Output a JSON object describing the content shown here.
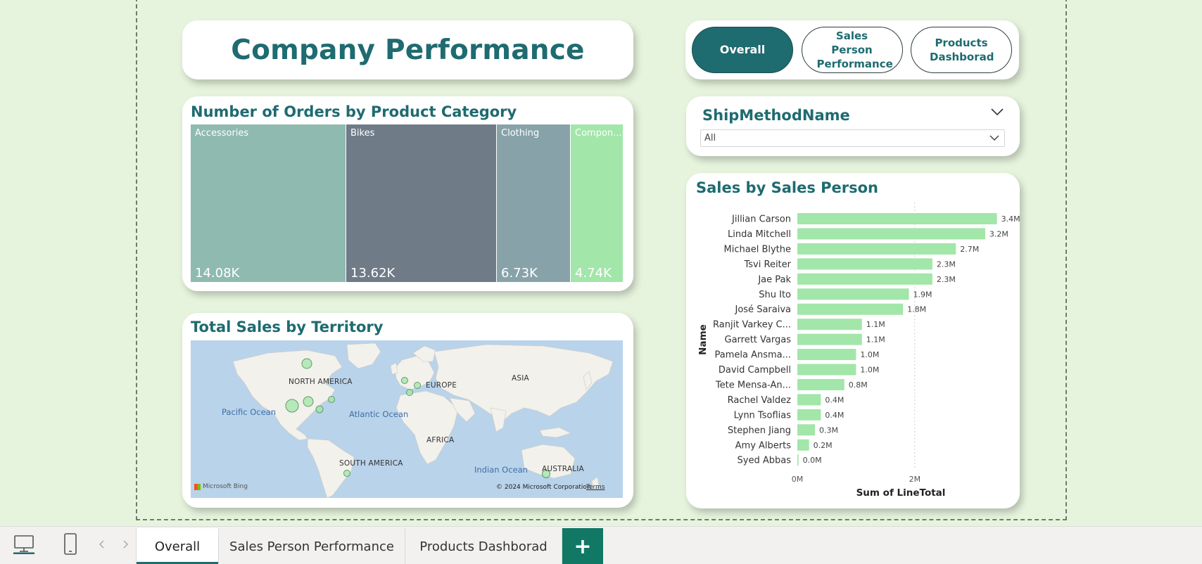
{
  "header": {
    "title": "Company Performance"
  },
  "nav_buttons": [
    {
      "label": "Overall",
      "active": true
    },
    {
      "label": "Sales Person Performance",
      "active": false
    },
    {
      "label": "Products Dashborad",
      "active": false
    }
  ],
  "treemap": {
    "title": "Number of Orders by Product Category",
    "tiles": [
      {
        "label": "Accessories",
        "value": "14.08K",
        "color": "#8fbab0"
      },
      {
        "label": "Bikes",
        "value": "13.62K",
        "color": "#6f7b87"
      },
      {
        "label": "Clothing",
        "value": "6.73K",
        "color": "#87a3a9"
      },
      {
        "label": "Compon...",
        "value": "4.74K",
        "color": "#a2e6a9"
      }
    ]
  },
  "map": {
    "title": "Total Sales by Territory",
    "labels": {
      "north_america": "NORTH AMERICA",
      "europe": "EUROPE",
      "asia": "ASIA",
      "africa": "AFRICA",
      "south_america": "SOUTH AMERICA",
      "australia": "AUSTRALIA",
      "pacific": "Pacific Ocean",
      "atlantic": "Atlantic Ocean",
      "indian": "Indian Ocean"
    },
    "bing": "Microsoft Bing",
    "copyright": "© 2024 Microsoft Corporation",
    "terms": "Terms"
  },
  "slicer": {
    "title": "ShipMethodName",
    "value": "All"
  },
  "chart_data": {
    "type": "bar",
    "orientation": "horizontal",
    "title": "Sales by Sales Person",
    "xlabel": "Sum of LineTotal",
    "ylabel": "Name",
    "xlim": [
      0,
      3600000
    ],
    "x_ticks": [
      "0M",
      "2M"
    ],
    "grid": true,
    "color": "#a2e6a9",
    "categories": [
      "Jillian Carson",
      "Linda Mitchell",
      "Michael Blythe",
      "Tsvi Reiter",
      "Jae Pak",
      "Shu Ito",
      "José Saraiva",
      "Ranjit Varkey C...",
      "Garrett Vargas",
      "Pamela Ansma...",
      "David Campbell",
      "Tete Mensa-An...",
      "Rachel Valdez",
      "Lynn Tsoflias",
      "Stephen Jiang",
      "Amy Alberts",
      "Syed Abbas"
    ],
    "values": [
      3400000,
      3200000,
      2700000,
      2300000,
      2300000,
      1900000,
      1800000,
      1100000,
      1100000,
      1000000,
      1000000,
      800000,
      400000,
      400000,
      300000,
      200000,
      20000
    ],
    "data_labels": [
      "3.4M",
      "3.2M",
      "2.7M",
      "2.3M",
      "2.3M",
      "1.9M",
      "1.8M",
      "1.1M",
      "1.1M",
      "1.0M",
      "1.0M",
      "0.8M",
      "0.4M",
      "0.4M",
      "0.3M",
      "0.2M",
      "0.0M"
    ]
  },
  "tabbar": {
    "tabs": [
      {
        "label": "Overall",
        "active": true
      },
      {
        "label": "Sales Person Performance",
        "active": false
      },
      {
        "label": "Products Dashborad",
        "active": false
      }
    ],
    "add_label": "+"
  },
  "icons": {
    "desktop": "desktop-icon",
    "mobile": "mobile-icon",
    "prev": "chevron-left-icon",
    "next": "chevron-right-icon"
  },
  "colors": {
    "accent": "#1e6b70",
    "background": "#e6f4dd",
    "add_tab": "#117865"
  }
}
